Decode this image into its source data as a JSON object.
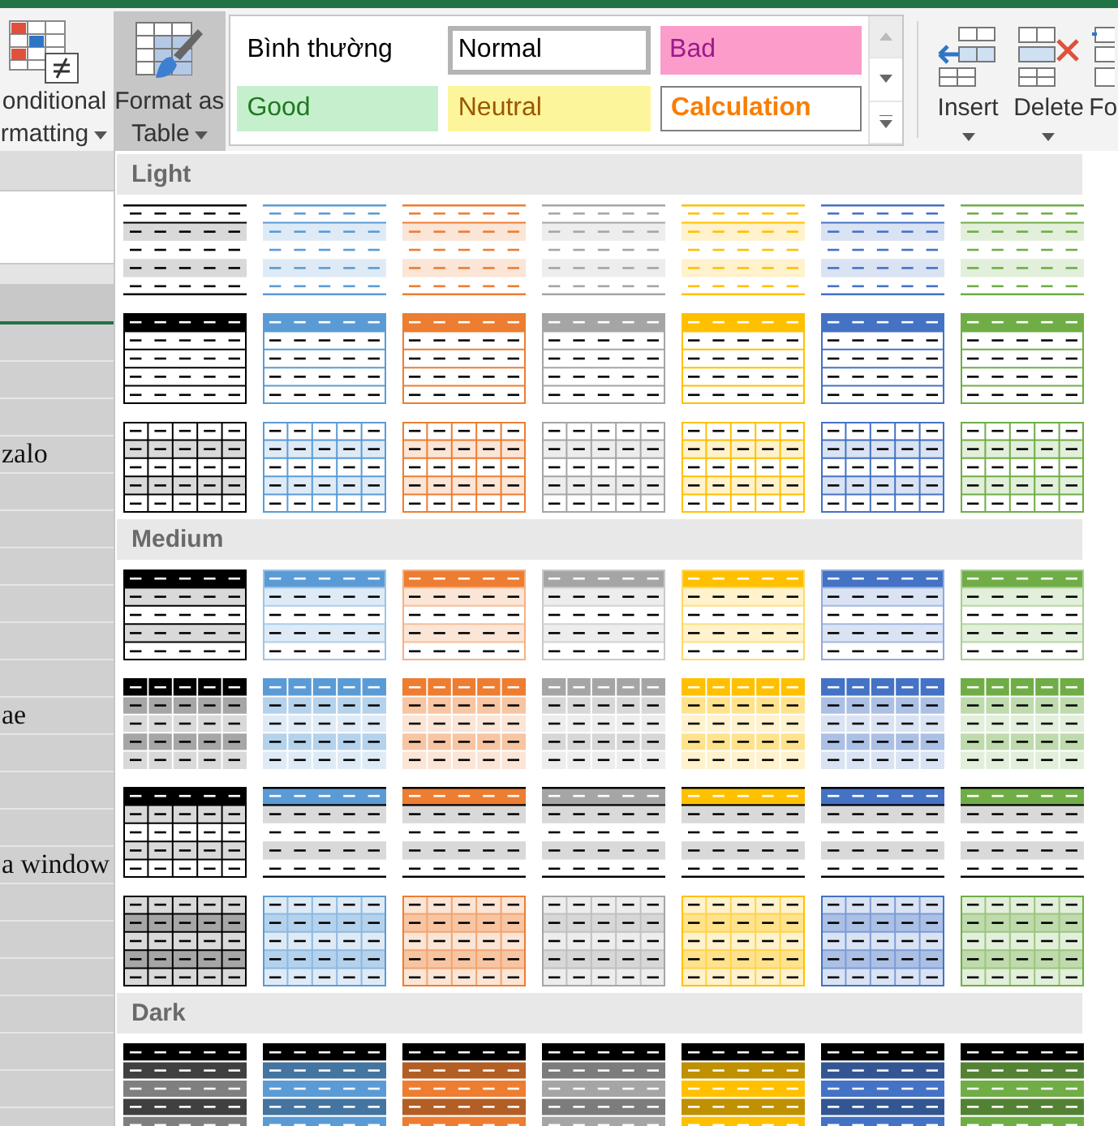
{
  "ribbon": {
    "left_buttons": [
      {
        "kind": "conditional-formatting",
        "label_lines": [
          "onditional",
          "rmatting"
        ],
        "pressed": false,
        "dropdown": true
      },
      {
        "kind": "format-as-table",
        "label_lines": [
          "Format as",
          "Table"
        ],
        "pressed": true,
        "dropdown": true
      }
    ],
    "cell_styles": {
      "items": [
        {
          "label": "Bình thường",
          "kind": "plain",
          "selected": false
        },
        {
          "label": "Normal",
          "kind": "normal",
          "selected": true
        },
        {
          "label": "Bad",
          "kind": "bad",
          "selected": false
        },
        {
          "label": "Good",
          "kind": "good",
          "selected": false
        },
        {
          "label": "Neutral",
          "kind": "neutral",
          "selected": false
        },
        {
          "label": "Calculation",
          "kind": "calculation",
          "selected": false
        }
      ]
    },
    "right_buttons": [
      {
        "kind": "insert",
        "label": "Insert",
        "dropdown": true
      },
      {
        "kind": "delete",
        "label": "Delete",
        "dropdown": true
      },
      {
        "kind": "format",
        "label": "Fo",
        "dropdown": false
      }
    ]
  },
  "sheet": {
    "cells": [
      {},
      {},
      {},
      {
        "text": "zalo"
      },
      {},
      {},
      {},
      {},
      {},
      {},
      {
        "text": "ae"
      },
      {},
      {},
      {},
      {
        "text": "a window"
      },
      {},
      {},
      {},
      {},
      {},
      {},
      {}
    ]
  },
  "table_styles": {
    "sections": [
      {
        "title": "Light",
        "rows": [
          {
            "kind": "light-banded",
            "styles": [
              {
                "color": "#000000",
                "selected": false
              },
              {
                "color": "#5b9bd5",
                "selected": false
              },
              {
                "color": "#ed7d31",
                "selected": false
              },
              {
                "color": "#a5a5a5",
                "selected": false
              },
              {
                "color": "#ffc000",
                "selected": false
              },
              {
                "color": "#4472c4",
                "selected": false
              },
              {
                "color": "#70ad47",
                "selected": false
              }
            ]
          },
          {
            "kind": "light-header",
            "styles": [
              {
                "color": "#000000",
                "selected": false
              },
              {
                "color": "#5b9bd5",
                "selected": false
              },
              {
                "color": "#ed7d31",
                "selected": false
              },
              {
                "color": "#a5a5a5",
                "selected": false
              },
              {
                "color": "#ffc000",
                "selected": false
              },
              {
                "color": "#4472c4",
                "selected": false
              },
              {
                "color": "#70ad47",
                "selected": false
              }
            ]
          },
          {
            "kind": "light-grid",
            "styles": [
              {
                "color": "#000000",
                "selected": false
              },
              {
                "color": "#5b9bd5",
                "selected": false
              },
              {
                "color": "#ed7d31",
                "selected": false
              },
              {
                "color": "#a5a5a5",
                "selected": false
              },
              {
                "color": "#ffc000",
                "selected": false
              },
              {
                "color": "#4472c4",
                "selected": false
              },
              {
                "color": "#70ad47",
                "selected": false
              }
            ]
          }
        ]
      },
      {
        "title": "Medium",
        "rows": [
          {
            "kind": "medium-banded",
            "styles": [
              {
                "color": "#000000",
                "selected": false
              },
              {
                "color": "#5b9bd5",
                "selected": false
              },
              {
                "color": "#ed7d31",
                "selected": false
              },
              {
                "color": "#a5a5a5",
                "selected": false
              },
              {
                "color": "#ffc000",
                "selected": false
              },
              {
                "color": "#4472c4",
                "selected": false
              },
              {
                "color": "#70ad47",
                "selected": false
              }
            ]
          },
          {
            "kind": "medium-grid",
            "styles": [
              {
                "color": "#000000",
                "selected": false
              },
              {
                "color": "#5b9bd5",
                "selected": false
              },
              {
                "color": "#ed7d31",
                "selected": false
              },
              {
                "color": "#a5a5a5",
                "selected": false
              },
              {
                "color": "#ffc000",
                "selected": false
              },
              {
                "color": "#4472c4",
                "selected": false
              },
              {
                "color": "#70ad47",
                "selected": false
              }
            ]
          },
          {
            "kind": "medium-rule",
            "styles": [
              {
                "color": "#000000",
                "selected": false
              },
              {
                "color": "#5b9bd5",
                "selected": false
              },
              {
                "color": "#ed7d31",
                "selected": false
              },
              {
                "color": "#a5a5a5",
                "selected": false
              },
              {
                "color": "#ffc000",
                "selected": false
              },
              {
                "color": "#4472c4",
                "selected": false
              },
              {
                "color": "#70ad47",
                "selected": false
              }
            ]
          },
          {
            "kind": "medium-tint-grid",
            "styles": [
              {
                "color": "#000000",
                "selected": false
              },
              {
                "color": "#5b9bd5",
                "selected": false
              },
              {
                "color": "#ed7d31",
                "selected": false
              },
              {
                "color": "#a5a5a5",
                "selected": false
              },
              {
                "color": "#ffc000",
                "selected": false
              },
              {
                "color": "#4472c4",
                "selected": false
              },
              {
                "color": "#70ad47",
                "selected": false
              }
            ]
          }
        ]
      },
      {
        "title": "Dark",
        "rows": [
          {
            "kind": "dark-banded",
            "styles": [
              {
                "color": "#000000",
                "selected": false
              },
              {
                "color": "#5b9bd5",
                "selected": false
              },
              {
                "color": "#ed7d31",
                "selected": false
              },
              {
                "color": "#a5a5a5",
                "selected": false
              },
              {
                "color": "#ffc000",
                "selected": false
              },
              {
                "color": "#4472c4",
                "selected": false
              },
              {
                "color": "#70ad47",
                "selected": false
              }
            ]
          }
        ]
      }
    ]
  }
}
